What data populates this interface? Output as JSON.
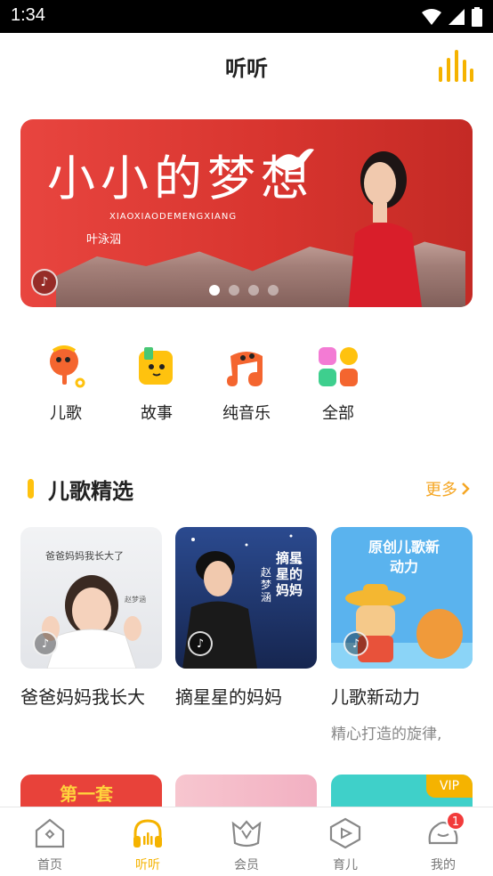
{
  "status_bar": {
    "time": "1:34",
    "icons": [
      "wifi-icon",
      "signal-icon",
      "battery-icon"
    ]
  },
  "header": {
    "title": "听听",
    "action_icon": "equalizer-icon"
  },
  "banner": {
    "title": "小小的梦想",
    "subtitle": "XIAOXIAODEMENGXIANG",
    "singer": "叶泳泅",
    "page_count": 4,
    "active_page": 1
  },
  "categories": [
    {
      "label": "儿歌",
      "icon": "maraca-icon"
    },
    {
      "label": "故事",
      "icon": "book-icon"
    },
    {
      "label": "纯音乐",
      "icon": "music-note-icon"
    },
    {
      "label": "全部",
      "icon": "grid-icon"
    }
  ],
  "section": {
    "title": "儿歌精选",
    "more": "更多"
  },
  "cards": [
    {
      "name": "爸爸妈妈我长大",
      "cover_text": "爸爸妈妈我长大了",
      "cover_caption": "赵梦涵"
    },
    {
      "name": "摘星星的妈妈",
      "cover_text": "摘星星的妈妈",
      "cover_caption": "赵梦涵"
    },
    {
      "name": "儿歌新动力",
      "desc": "精心打造的旋律,",
      "cover_text": "原创儿歌新动力"
    }
  ],
  "row2_cards": [
    {
      "cover_text": "第一套"
    },
    {
      "cover_text": ""
    },
    {
      "cover_text": "",
      "vip": "VIP"
    }
  ],
  "tabs": [
    {
      "label": "首页",
      "icon": "home-icon",
      "active": false
    },
    {
      "label": "听听",
      "icon": "headphones-icon",
      "active": true
    },
    {
      "label": "会员",
      "icon": "vip-crown-icon",
      "active": false
    },
    {
      "label": "育儿",
      "icon": "parenting-icon",
      "active": false
    },
    {
      "label": "我的",
      "icon": "profile-icon",
      "active": false,
      "badge": "1"
    }
  ],
  "colors": {
    "accent": "#f5b300",
    "banner": "#e04039",
    "text": "#222222",
    "muted": "#888888"
  }
}
